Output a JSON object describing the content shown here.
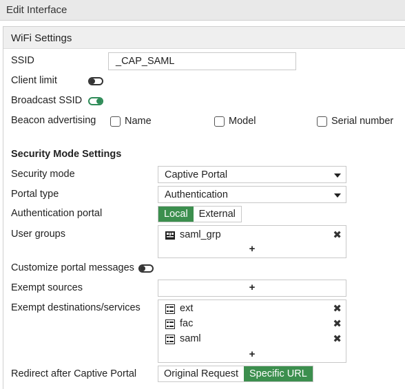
{
  "window": {
    "title": "Edit Interface"
  },
  "wifi": {
    "header": "WiFi Settings",
    "ssid_label": "SSID",
    "ssid_value": "_CAP_SAML",
    "client_limit_label": "Client limit",
    "client_limit_on": false,
    "broadcast_label": "Broadcast SSID",
    "broadcast_on": true,
    "beacon_label": "Beacon advertising",
    "beacon_options": [
      {
        "label": "Name",
        "checked": false
      },
      {
        "label": "Model",
        "checked": false
      },
      {
        "label": "Serial number",
        "checked": false
      }
    ]
  },
  "security": {
    "title": "Security Mode Settings",
    "mode_label": "Security mode",
    "mode_value": "Captive Portal",
    "portal_type_label": "Portal type",
    "portal_type_value": "Authentication",
    "auth_portal_label": "Authentication portal",
    "auth_portal_options": [
      "Local",
      "External"
    ],
    "auth_portal_selected": "Local",
    "user_groups_label": "User groups",
    "user_groups": [
      "saml_grp"
    ],
    "add_symbol": "+",
    "remove_symbol": "✖",
    "customize_label": "Customize portal messages",
    "customize_on": false,
    "exempt_sources_label": "Exempt sources",
    "exempt_dest_label": "Exempt destinations/services",
    "exempt_dest": [
      "ext",
      "fac",
      "saml"
    ],
    "redirect_label": "Redirect after Captive Portal",
    "redirect_options": [
      "Original Request",
      "Specific URL"
    ],
    "redirect_selected": "Specific URL"
  }
}
